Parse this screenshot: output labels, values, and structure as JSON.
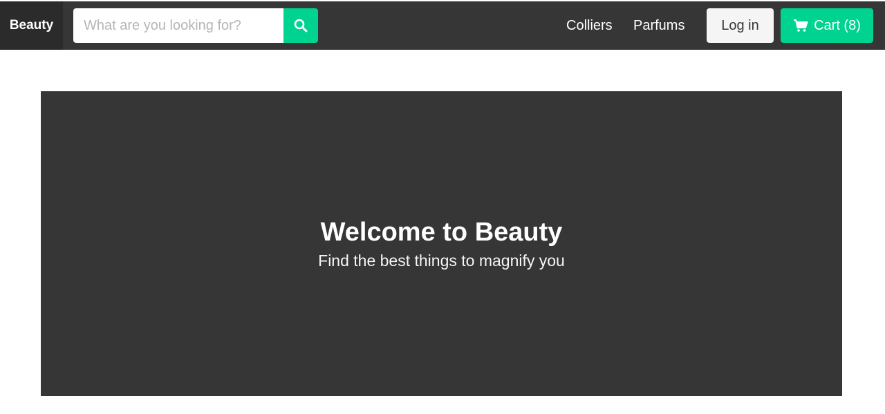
{
  "navbar": {
    "brand": "Beauty",
    "search": {
      "placeholder": "What are you looking for?",
      "value": "",
      "button_icon": "search-icon"
    },
    "links": [
      {
        "label": "Colliers"
      },
      {
        "label": "Parfums"
      }
    ],
    "login_label": "Log in",
    "cart": {
      "icon": "cart-icon",
      "label": "Cart (8)"
    }
  },
  "hero": {
    "title": "Welcome to Beauty",
    "subtitle": "Find the best things to magnify you"
  },
  "colors": {
    "navbar_bg": "#363636",
    "brand_bg": "#2b2b2b",
    "accent": "#00d38f",
    "login_bg": "#f5f5f5",
    "hero_bg": "#363636"
  }
}
